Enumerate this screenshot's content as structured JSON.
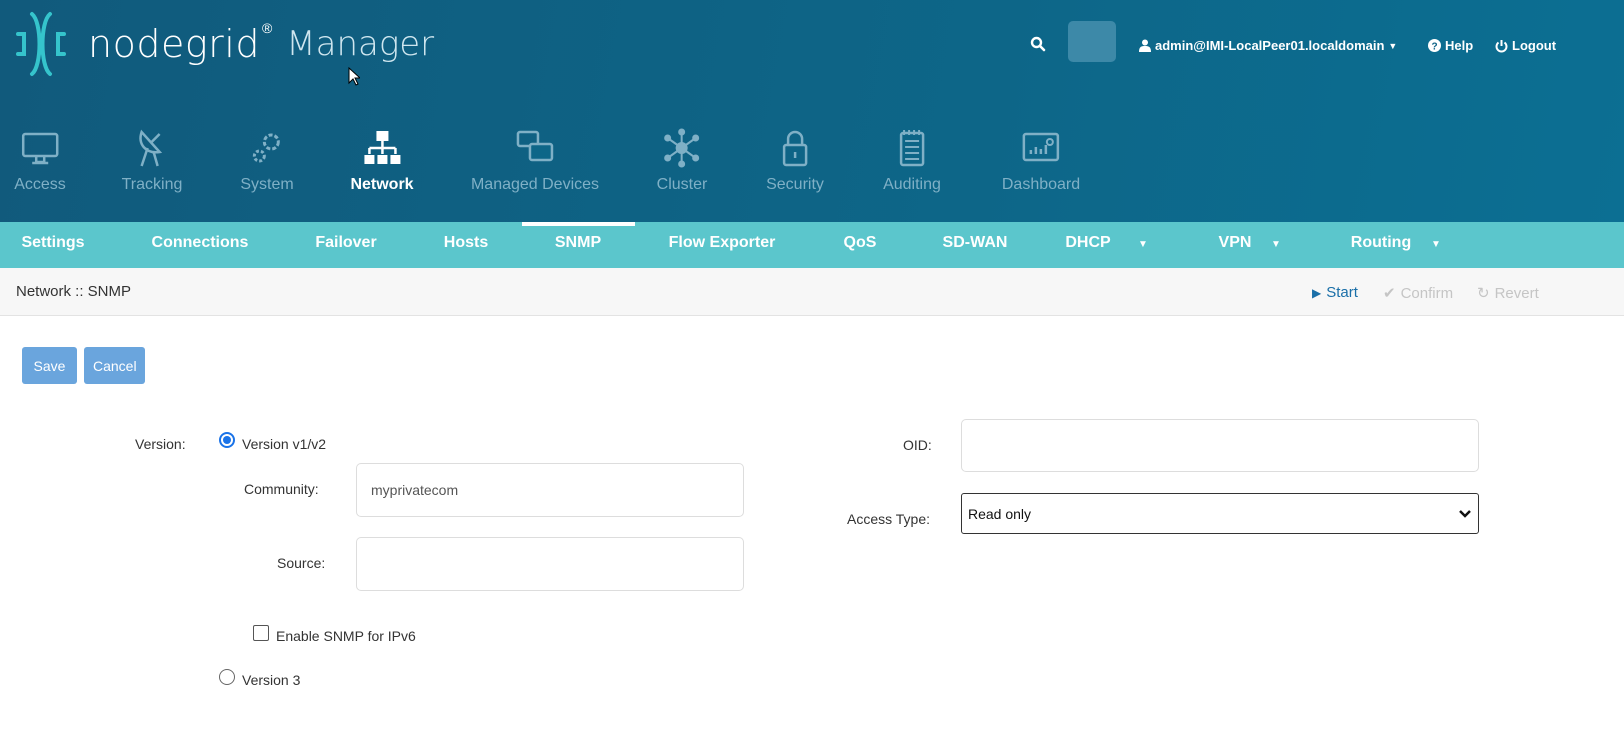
{
  "header": {
    "logo_text": "nodegrid",
    "logo_reg": "®",
    "logo_suffix": "Manager",
    "user": "admin@IMI-LocalPeer01.localdomain",
    "help": "Help",
    "logout": "Logout"
  },
  "nav": [
    {
      "label": "Access",
      "icon": "monitor-icon"
    },
    {
      "label": "Tracking",
      "icon": "satellite-icon"
    },
    {
      "label": "System",
      "icon": "gears-icon"
    },
    {
      "label": "Network",
      "icon": "network-icon",
      "active": true
    },
    {
      "label": "Managed Devices",
      "icon": "devices-icon"
    },
    {
      "label": "Cluster",
      "icon": "cluster-icon"
    },
    {
      "label": "Security",
      "icon": "lock-icon"
    },
    {
      "label": "Auditing",
      "icon": "notepad-icon"
    },
    {
      "label": "Dashboard",
      "icon": "dashboard-icon"
    }
  ],
  "subnav": [
    "Settings",
    "Connections",
    "Failover",
    "Hosts",
    "SNMP",
    "Flow Exporter",
    "QoS",
    "SD-WAN",
    "DHCP",
    "VPN",
    "Routing"
  ],
  "subnav_active": "SNMP",
  "breadcrumb": "Network :: SNMP",
  "actions": {
    "start": "Start",
    "confirm": "Confirm",
    "revert": "Revert"
  },
  "buttons": {
    "save": "Save",
    "cancel": "Cancel"
  },
  "form": {
    "version_label": "Version:",
    "v1v2": "Version v1/v2",
    "v3": "Version 3",
    "selected_version": "Version v1/v2",
    "community_label": "Community:",
    "community_value": "myprivatecom",
    "source_label": "Source:",
    "source_value": "",
    "ipv6_label": "Enable SNMP for IPv6",
    "ipv6_checked": false,
    "oid_label": "OID:",
    "oid_value": "",
    "access_label": "Access Type:",
    "access_value": "Read only"
  },
  "colors": {
    "header": "#0e6286",
    "subnav": "#5bc6cc",
    "accent": "#1a6fa8",
    "button": "#6aa5dd"
  }
}
